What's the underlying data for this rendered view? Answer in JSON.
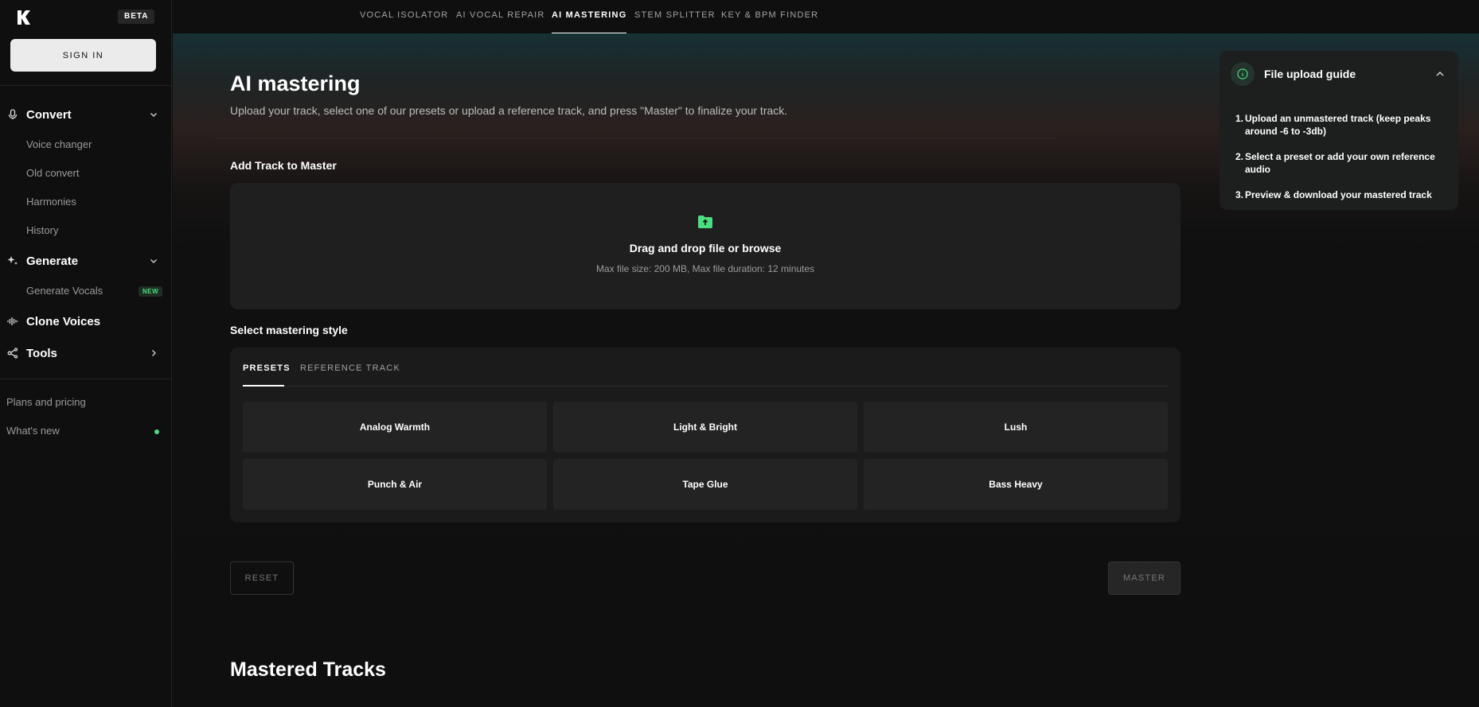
{
  "sidebar": {
    "beta": "BETA",
    "sign_in": "SIGN IN",
    "sections": [
      {
        "label": "Convert",
        "icon": "mic-icon",
        "items": [
          "Voice changer",
          "Old convert",
          "Harmonies",
          "History"
        ]
      },
      {
        "label": "Generate",
        "icon": "sparkle-icon",
        "items": [
          "Generate Vocals"
        ]
      },
      {
        "label": "Clone Voices",
        "icon": "waveform-icon"
      },
      {
        "label": "Tools",
        "icon": "tools-icon"
      }
    ],
    "new_badge": "NEW",
    "footer": [
      "Plans and pricing",
      "What's new"
    ]
  },
  "topnav": {
    "tabs": [
      "VOCAL ISOLATOR",
      "AI VOCAL REPAIR",
      "AI MASTERING",
      "STEM SPLITTER",
      "KEY & BPM FINDER"
    ],
    "active": "AI MASTERING"
  },
  "main": {
    "title": "AI mastering",
    "subtitle": "Upload your track, select one of our presets or upload a reference track, and press \"Master\" to finalize your track.",
    "add_track_label": "Add Track to Master",
    "dropzone": {
      "main": "Drag and drop file or browse",
      "sub": "Max file size: 200 MB, Max file duration: 12 minutes"
    },
    "style_label": "Select mastering style",
    "style_tabs": [
      "PRESETS",
      "REFERENCE TRACK"
    ],
    "presets": [
      "Analog Warmth",
      "Light & Bright",
      "Lush",
      "Punch & Air",
      "Tape Glue",
      "Bass Heavy"
    ],
    "reset": "RESET",
    "master": "MASTER",
    "mastered_title": "Mastered Tracks"
  },
  "guide": {
    "title": "File upload guide",
    "steps": [
      "Upload an unmastered track (keep peaks around -6 to -3db)",
      "Select a preset or add your own reference audio",
      "Preview & download your mastered track"
    ]
  },
  "colors": {
    "accent_green": "#4ade80",
    "background": "#0f0f0f",
    "panel": "#1f1f1f"
  }
}
